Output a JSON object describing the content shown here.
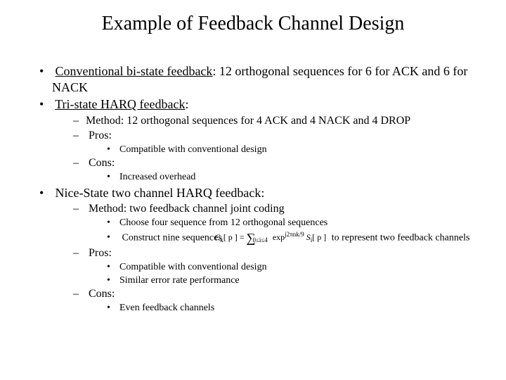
{
  "title": "Example of Feedback Channel Design",
  "b1_label": "Conventional bi-state feedback",
  "b1_rest": ": 12 orthogonal sequences for 6 for ACK and 6 for NACK",
  "b2_label": "Tri-state HARQ feedback",
  "b2_colon": ":",
  "b2_method": "Method: 12 orthogonal sequences for 4 ACK and 4 NACK and 4 DROP",
  "pros_label": "Pros:",
  "cons_label": "Cons:",
  "b2_pro1": "Compatible with conventional design",
  "b2_con1": "Increased overhead",
  "b3_label": "Nice-State two channel HARQ feedback",
  "b3_colon": ":",
  "b3_method": "Method: two feedback channel joint coding",
  "b3_m1": "Choose four sequence from 12 orthogonal sequences",
  "b3_m2_pre": "Construct nine sequences",
  "b3_m2_post": "to represent two feedback channels",
  "b3_pro1": "Compatible with conventional design",
  "b3_pro2": "Similar error rate performance",
  "b3_con1": "Even feedback channels",
  "formula": {
    "lhs_C": "C",
    "lhs_k": "k",
    "lhs_p": "[ p ]",
    "eq": "=",
    "sum": "∑",
    "sum_lim": "0≤i≤4",
    "exp": "exp",
    "exponent": "j2πnk/9",
    "Si": "S",
    "i": "i",
    "Sip": "[ p ]"
  }
}
